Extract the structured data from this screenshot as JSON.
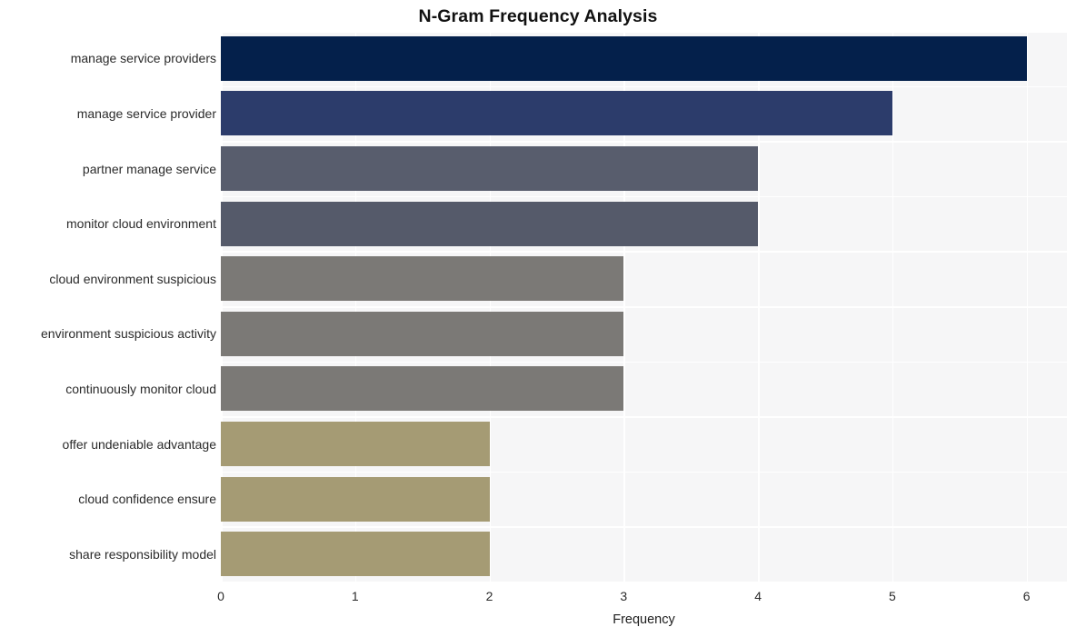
{
  "chart_data": {
    "type": "bar",
    "orientation": "horizontal",
    "title": "N-Gram Frequency Analysis",
    "xlabel": "Frequency",
    "ylabel": "",
    "xlim": [
      0,
      6.3
    ],
    "xticks": [
      0,
      1,
      2,
      3,
      4,
      5,
      6
    ],
    "xticklabels": [
      "0",
      "1",
      "2",
      "3",
      "4",
      "5",
      "6"
    ],
    "grid": true,
    "grid_color": "#ffffff",
    "legend": "none",
    "plot_background": "#f6f6f7",
    "figure_background": "#ffffff",
    "categories": [
      "manage service providers",
      "manage service provider",
      "partner manage service",
      "monitor cloud environment",
      "cloud environment suspicious",
      "environment suspicious activity",
      "continuously monitor cloud",
      "offer undeniable advantage",
      "cloud confidence ensure",
      "share responsibility model"
    ],
    "values": [
      6,
      5,
      4,
      4,
      3,
      3,
      3,
      2,
      2,
      2
    ],
    "bar_colors": [
      "#04204b",
      "#2c3c6b",
      "#585d6d",
      "#555a6a",
      "#7b7976",
      "#7b7976",
      "#7b7976",
      "#a59b74",
      "#a59b74",
      "#a59b74"
    ]
  }
}
